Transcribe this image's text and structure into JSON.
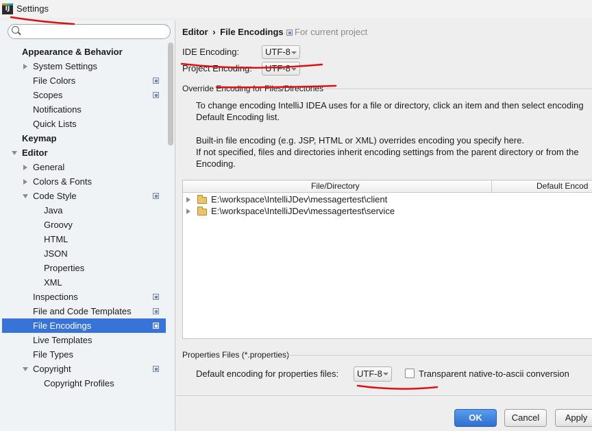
{
  "window": {
    "title": "Settings"
  },
  "search": {
    "placeholder": "",
    "value": ""
  },
  "sidebar": {
    "items": [
      {
        "label": "Appearance & Behavior"
      },
      {
        "label": "System Settings"
      },
      {
        "label": "File Colors"
      },
      {
        "label": "Scopes"
      },
      {
        "label": "Notifications"
      },
      {
        "label": "Quick Lists"
      },
      {
        "label": "Keymap"
      },
      {
        "label": "Editor"
      },
      {
        "label": "General"
      },
      {
        "label": "Colors & Fonts"
      },
      {
        "label": "Code Style"
      },
      {
        "label": "Java"
      },
      {
        "label": "Groovy"
      },
      {
        "label": "HTML"
      },
      {
        "label": "JSON"
      },
      {
        "label": "Properties"
      },
      {
        "label": "XML"
      },
      {
        "label": "Inspections"
      },
      {
        "label": "File and Code Templates"
      },
      {
        "label": "File Encodings"
      },
      {
        "label": "Live Templates"
      },
      {
        "label": "File Types"
      },
      {
        "label": "Copyright"
      },
      {
        "label": "Copyright Profiles"
      }
    ],
    "selected": "File Encodings"
  },
  "breadcrumb": {
    "parent": "Editor",
    "separator": "›",
    "current": "File Encodings",
    "scope_note": "For current project"
  },
  "encodings": {
    "ide_label": "IDE Encoding:",
    "ide_value": "UTF-8",
    "project_label": "Project Encoding:",
    "project_value": "UTF-8"
  },
  "override": {
    "section_title": "Override Encoding for Files/Directories",
    "desc_line1": "To change encoding IntelliJ IDEA uses for a file or directory, click an item and then select encoding",
    "desc_line2": "Default Encoding list.",
    "desc_line3": "Built-in file encoding (e.g. JSP, HTML or XML) overrides encoding you specify here.",
    "desc_line4": "If not specified, files and directories inherit encoding settings from the parent directory or from the",
    "desc_line5": "Encoding.",
    "table": {
      "columns": [
        "File/Directory",
        "Default Encod"
      ],
      "rows": [
        {
          "path": "E:\\workspace\\IntelliJDev\\messagertest\\client",
          "encoding": ""
        },
        {
          "path": "E:\\workspace\\IntelliJDev\\messagertest\\service",
          "encoding": ""
        }
      ]
    }
  },
  "properties": {
    "section_title": "Properties Files (*.properties)",
    "default_label": "Default encoding for properties files:",
    "default_value": "UTF-8",
    "transparent_label": "Transparent native-to-ascii conversion",
    "transparent_checked": false
  },
  "buttons": {
    "ok": "OK",
    "cancel": "Cancel",
    "apply": "Apply"
  },
  "colors": {
    "selection": "#3874d8",
    "primary_button": "#3a7de0",
    "annotation_red": "#e01010"
  }
}
